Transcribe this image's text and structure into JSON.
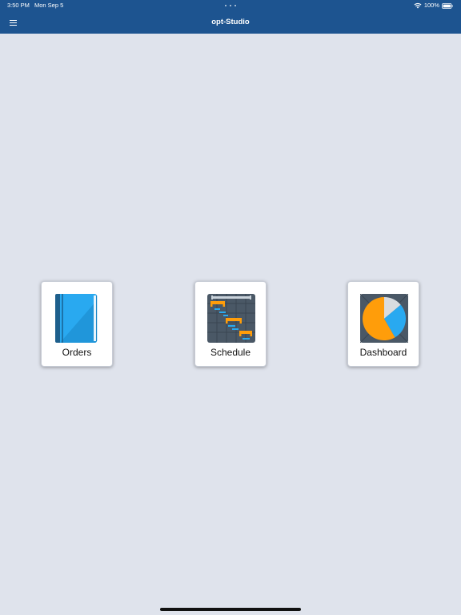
{
  "status_bar": {
    "time": "3:50 PM",
    "date": "Mon Sep 5",
    "battery": "100%"
  },
  "header": {
    "title": "opt-Studio",
    "menu_icon": "hamburger-menu-icon"
  },
  "tiles": [
    {
      "label": "Orders",
      "icon": "book-icon"
    },
    {
      "label": "Schedule",
      "icon": "gantt-chart-icon"
    },
    {
      "label": "Dashboard",
      "icon": "pie-chart-icon"
    }
  ],
  "colors": {
    "header_background": "#1d5490",
    "page_background": "#dfe3ec",
    "tile_background": "#ffffff",
    "accent_blue": "#29a9f0",
    "accent_orange": "#ff9d0a"
  }
}
